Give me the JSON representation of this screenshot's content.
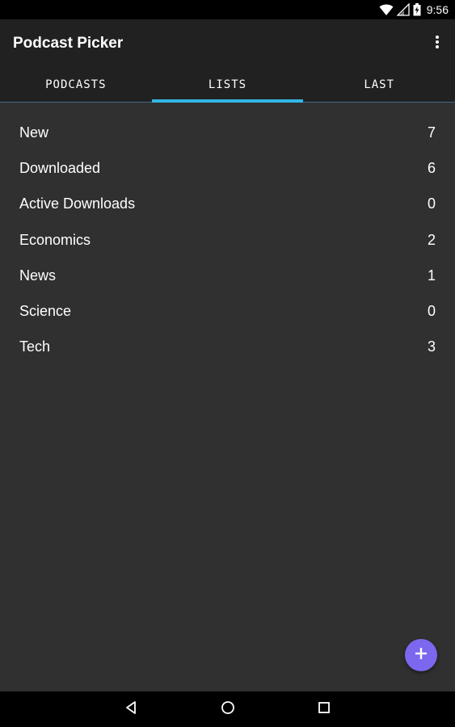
{
  "status_bar": {
    "time": "9:56",
    "icons": [
      "wifi-icon",
      "signal-icon",
      "battery-icon"
    ]
  },
  "app_bar": {
    "title": "Podcast Picker",
    "overflow_icon": "more-vert-icon"
  },
  "tabs": [
    {
      "label": "PODCASTS",
      "selected": false
    },
    {
      "label": "LISTS",
      "selected": true
    },
    {
      "label": "LAST",
      "selected": false
    }
  ],
  "lists": [
    {
      "label": "New",
      "count": "7"
    },
    {
      "label": "Downloaded",
      "count": "6"
    },
    {
      "label": "Active Downloads",
      "count": "0"
    },
    {
      "label": "Economics",
      "count": "2"
    },
    {
      "label": "News",
      "count": "1"
    },
    {
      "label": "Science",
      "count": "0"
    },
    {
      "label": "Tech",
      "count": "3"
    }
  ],
  "fab": {
    "icon": "add-icon"
  },
  "nav_bar": {
    "icons": [
      "back-icon",
      "home-icon",
      "recents-icon"
    ]
  },
  "colors": {
    "background": "#303030",
    "app_bar": "#212121",
    "tab_indicator": "#33b5e5",
    "fab": "#7b68ee"
  }
}
